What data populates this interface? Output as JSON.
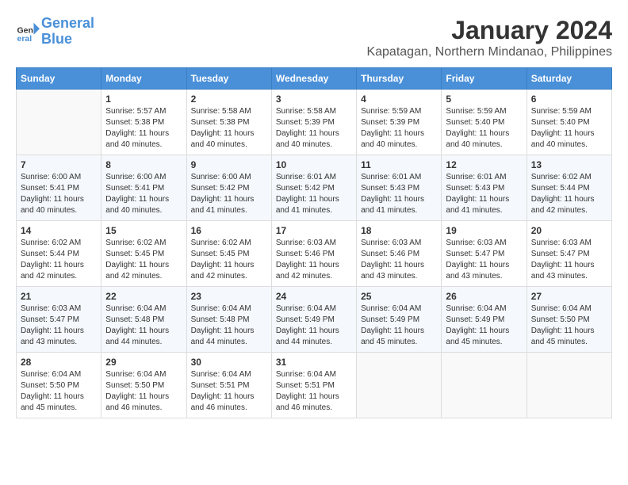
{
  "header": {
    "logo_line1": "General",
    "logo_line2": "Blue",
    "month_year": "January 2024",
    "location": "Kapatagan, Northern Mindanao, Philippines"
  },
  "days_of_week": [
    "Sunday",
    "Monday",
    "Tuesday",
    "Wednesday",
    "Thursday",
    "Friday",
    "Saturday"
  ],
  "weeks": [
    [
      {
        "day": "",
        "info": ""
      },
      {
        "day": "1",
        "info": "Sunrise: 5:57 AM\nSunset: 5:38 PM\nDaylight: 11 hours\nand 40 minutes."
      },
      {
        "day": "2",
        "info": "Sunrise: 5:58 AM\nSunset: 5:38 PM\nDaylight: 11 hours\nand 40 minutes."
      },
      {
        "day": "3",
        "info": "Sunrise: 5:58 AM\nSunset: 5:39 PM\nDaylight: 11 hours\nand 40 minutes."
      },
      {
        "day": "4",
        "info": "Sunrise: 5:59 AM\nSunset: 5:39 PM\nDaylight: 11 hours\nand 40 minutes."
      },
      {
        "day": "5",
        "info": "Sunrise: 5:59 AM\nSunset: 5:40 PM\nDaylight: 11 hours\nand 40 minutes."
      },
      {
        "day": "6",
        "info": "Sunrise: 5:59 AM\nSunset: 5:40 PM\nDaylight: 11 hours\nand 40 minutes."
      }
    ],
    [
      {
        "day": "7",
        "info": "Sunrise: 6:00 AM\nSunset: 5:41 PM\nDaylight: 11 hours\nand 40 minutes."
      },
      {
        "day": "8",
        "info": "Sunrise: 6:00 AM\nSunset: 5:41 PM\nDaylight: 11 hours\nand 40 minutes."
      },
      {
        "day": "9",
        "info": "Sunrise: 6:00 AM\nSunset: 5:42 PM\nDaylight: 11 hours\nand 41 minutes."
      },
      {
        "day": "10",
        "info": "Sunrise: 6:01 AM\nSunset: 5:42 PM\nDaylight: 11 hours\nand 41 minutes."
      },
      {
        "day": "11",
        "info": "Sunrise: 6:01 AM\nSunset: 5:43 PM\nDaylight: 11 hours\nand 41 minutes."
      },
      {
        "day": "12",
        "info": "Sunrise: 6:01 AM\nSunset: 5:43 PM\nDaylight: 11 hours\nand 41 minutes."
      },
      {
        "day": "13",
        "info": "Sunrise: 6:02 AM\nSunset: 5:44 PM\nDaylight: 11 hours\nand 42 minutes."
      }
    ],
    [
      {
        "day": "14",
        "info": "Sunrise: 6:02 AM\nSunset: 5:44 PM\nDaylight: 11 hours\nand 42 minutes."
      },
      {
        "day": "15",
        "info": "Sunrise: 6:02 AM\nSunset: 5:45 PM\nDaylight: 11 hours\nand 42 minutes."
      },
      {
        "day": "16",
        "info": "Sunrise: 6:02 AM\nSunset: 5:45 PM\nDaylight: 11 hours\nand 42 minutes."
      },
      {
        "day": "17",
        "info": "Sunrise: 6:03 AM\nSunset: 5:46 PM\nDaylight: 11 hours\nand 42 minutes."
      },
      {
        "day": "18",
        "info": "Sunrise: 6:03 AM\nSunset: 5:46 PM\nDaylight: 11 hours\nand 43 minutes."
      },
      {
        "day": "19",
        "info": "Sunrise: 6:03 AM\nSunset: 5:47 PM\nDaylight: 11 hours\nand 43 minutes."
      },
      {
        "day": "20",
        "info": "Sunrise: 6:03 AM\nSunset: 5:47 PM\nDaylight: 11 hours\nand 43 minutes."
      }
    ],
    [
      {
        "day": "21",
        "info": "Sunrise: 6:03 AM\nSunset: 5:47 PM\nDaylight: 11 hours\nand 43 minutes."
      },
      {
        "day": "22",
        "info": "Sunrise: 6:04 AM\nSunset: 5:48 PM\nDaylight: 11 hours\nand 44 minutes."
      },
      {
        "day": "23",
        "info": "Sunrise: 6:04 AM\nSunset: 5:48 PM\nDaylight: 11 hours\nand 44 minutes."
      },
      {
        "day": "24",
        "info": "Sunrise: 6:04 AM\nSunset: 5:49 PM\nDaylight: 11 hours\nand 44 minutes."
      },
      {
        "day": "25",
        "info": "Sunrise: 6:04 AM\nSunset: 5:49 PM\nDaylight: 11 hours\nand 45 minutes."
      },
      {
        "day": "26",
        "info": "Sunrise: 6:04 AM\nSunset: 5:49 PM\nDaylight: 11 hours\nand 45 minutes."
      },
      {
        "day": "27",
        "info": "Sunrise: 6:04 AM\nSunset: 5:50 PM\nDaylight: 11 hours\nand 45 minutes."
      }
    ],
    [
      {
        "day": "28",
        "info": "Sunrise: 6:04 AM\nSunset: 5:50 PM\nDaylight: 11 hours\nand 45 minutes."
      },
      {
        "day": "29",
        "info": "Sunrise: 6:04 AM\nSunset: 5:50 PM\nDaylight: 11 hours\nand 46 minutes."
      },
      {
        "day": "30",
        "info": "Sunrise: 6:04 AM\nSunset: 5:51 PM\nDaylight: 11 hours\nand 46 minutes."
      },
      {
        "day": "31",
        "info": "Sunrise: 6:04 AM\nSunset: 5:51 PM\nDaylight: 11 hours\nand 46 minutes."
      },
      {
        "day": "",
        "info": ""
      },
      {
        "day": "",
        "info": ""
      },
      {
        "day": "",
        "info": ""
      }
    ]
  ]
}
